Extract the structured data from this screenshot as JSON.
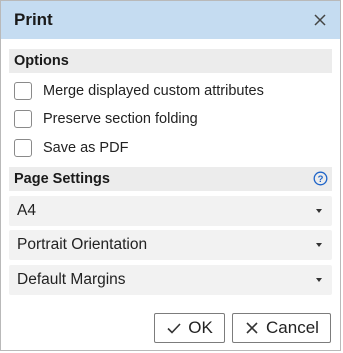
{
  "dialog": {
    "title": "Print",
    "close_icon": "close-icon"
  },
  "options": {
    "header": "Options",
    "items": [
      {
        "label": "Merge displayed custom attributes",
        "checked": false
      },
      {
        "label": "Preserve section folding",
        "checked": false
      },
      {
        "label": "Save as PDF",
        "checked": false
      }
    ]
  },
  "page_settings": {
    "header": "Page Settings",
    "help_icon": "help-icon",
    "paper_size": "A4",
    "orientation": "Portrait Orientation",
    "margins": "Default Margins"
  },
  "buttons": {
    "ok_label": "OK",
    "cancel_label": "Cancel"
  },
  "colors": {
    "titlebar": "#c5dcf1",
    "section_header": "#ececec",
    "select_bg": "#f2f2f2",
    "help_accent": "#1e64c8"
  }
}
